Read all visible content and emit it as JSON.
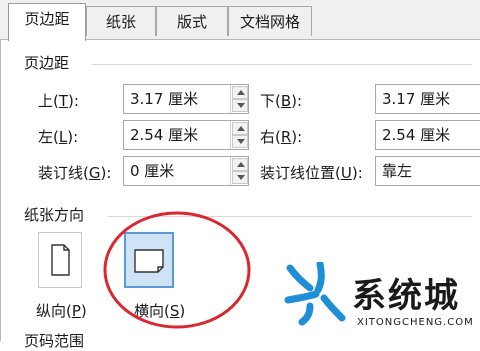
{
  "tabs": [
    {
      "label": "页边距"
    },
    {
      "label": "纸张"
    },
    {
      "label": "版式"
    },
    {
      "label": "文档网格"
    }
  ],
  "margins": {
    "section_title": "页边距",
    "top": {
      "label_prefix": "上(",
      "mnemonic": "T",
      "label_suffix": "):",
      "value": "3.17 厘米"
    },
    "bottom": {
      "label_prefix": "下(",
      "mnemonic": "B",
      "label_suffix": "):",
      "value": "3.17 厘米"
    },
    "left": {
      "label_prefix": "左(",
      "mnemonic": "L",
      "label_suffix": "):",
      "value": "2.54 厘米"
    },
    "right": {
      "label_prefix": "右(",
      "mnemonic": "R",
      "label_suffix": "):",
      "value": "2.54 厘米"
    },
    "gutter": {
      "label_prefix": "装订线(",
      "mnemonic": "G",
      "label_suffix": "):",
      "value": "0 厘米"
    },
    "gutter_position": {
      "label_prefix": "装订线位置(",
      "mnemonic": "U",
      "label_suffix": "):",
      "value": "靠左"
    }
  },
  "orientation": {
    "section_title": "纸张方向",
    "portrait": {
      "label_prefix": "纵向(",
      "mnemonic": "P",
      "label_suffix": ")"
    },
    "landscape": {
      "label_prefix": "横向(",
      "mnemonic": "S",
      "label_suffix": ")",
      "selected": true
    }
  },
  "pages": {
    "section_title": "页码范围"
  },
  "watermark": {
    "brand": "系统城",
    "url": "XITONGCHENG.COM"
  },
  "colors": {
    "annotation_circle": "#d9282f",
    "watermark_blue": "#1e8fd6",
    "selected_bg": "#cfe3f7",
    "selected_border": "#5b9bd5"
  }
}
